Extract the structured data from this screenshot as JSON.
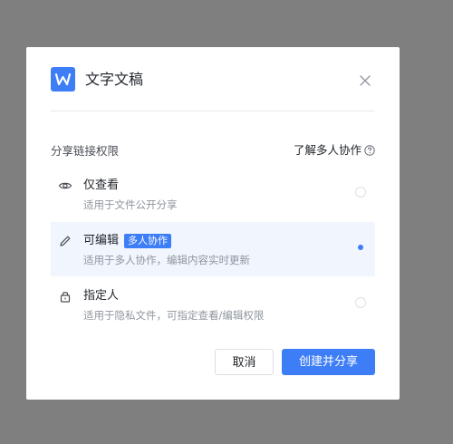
{
  "dialog": {
    "app_icon_letter": "W",
    "title": "文字文稿"
  },
  "share": {
    "section_label": "分享链接权限",
    "learn_link": "了解多人协作",
    "options": [
      {
        "title": "仅查看",
        "desc": "适用于文件公开分享",
        "icon": "eye-icon",
        "selected": false
      },
      {
        "title": "可编辑",
        "badge": "多人协作",
        "desc": "适用于多人协作，编辑内容实时更新",
        "icon": "pencil-icon",
        "selected": true
      },
      {
        "title": "指定人",
        "desc": "适用于隐私文件，可指定查看/编辑权限",
        "icon": "lock-icon",
        "selected": false
      }
    ]
  },
  "buttons": {
    "cancel": "取消",
    "create_share": "创建并分享"
  },
  "colors": {
    "overlay": "#7f7f7f",
    "accent": "#3d7df6",
    "selected_bg": "#f0f5fe"
  }
}
